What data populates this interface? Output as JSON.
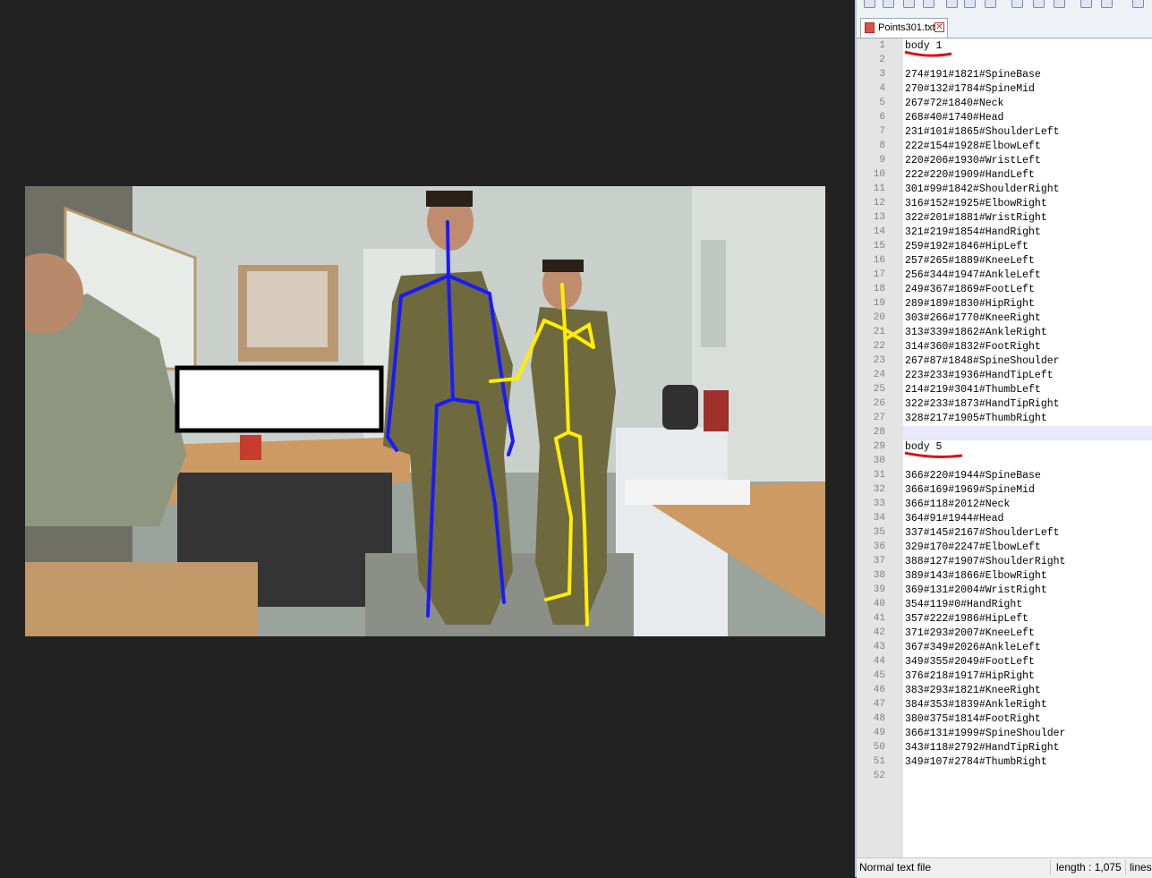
{
  "editor": {
    "tab_label": "Points301.txt",
    "close_glyph": "✕",
    "lines": [
      "body 1",
      "",
      "274#191#1821#SpineBase",
      "270#132#1784#SpineMid",
      "267#72#1840#Neck",
      "268#40#1740#Head",
      "231#101#1865#ShoulderLeft",
      "222#154#1928#ElbowLeft",
      "220#206#1930#WristLeft",
      "222#220#1909#HandLeft",
      "301#99#1842#ShoulderRight",
      "316#152#1925#ElbowRight",
      "322#201#1881#WristRight",
      "321#219#1854#HandRight",
      "259#192#1846#HipLeft",
      "257#265#1889#KneeLeft",
      "256#344#1947#AnkleLeft",
      "249#367#1869#FootLeft",
      "289#189#1830#HipRight",
      "303#266#1770#KneeRight",
      "313#339#1862#AnkleRight",
      "314#360#1832#FootRight",
      "267#87#1848#SpineShoulder",
      "223#233#1936#HandTipLeft",
      "214#219#3041#ThumbLeft",
      "322#233#1873#HandTipRight",
      "328#217#1905#ThumbRight",
      "",
      "body 5",
      "",
      "366#220#1944#SpineBase",
      "366#169#1969#SpineMid",
      "366#118#2012#Neck",
      "364#91#1944#Head",
      "337#145#2167#ShoulderLeft",
      "329#170#2247#ElbowLeft",
      "388#127#1907#ShoulderRight",
      "389#143#1866#ElbowRight",
      "369#131#2004#WristRight",
      "354#119#0#HandRight",
      "357#222#1986#HipLeft",
      "371#293#2007#KneeLeft",
      "367#349#2026#AnkleLeft",
      "349#355#2049#FootLeft",
      "376#218#1917#HipRight",
      "383#293#1821#KneeRight",
      "384#353#1839#AnkleRight",
      "380#375#1814#FootRight",
      "366#131#1999#SpineShoulder",
      "343#118#2792#HandTipRight",
      "349#107#2784#ThumbRight",
      ""
    ]
  },
  "status": {
    "file_type": "Normal text file",
    "length": "length : 1,075",
    "lines": "lines"
  },
  "colors": {
    "skeleton_body1": "#1a1aff",
    "skeleton_body5": "#ffee00",
    "annotation_underline": "#e01010",
    "current_line": "#e8e8ff"
  }
}
